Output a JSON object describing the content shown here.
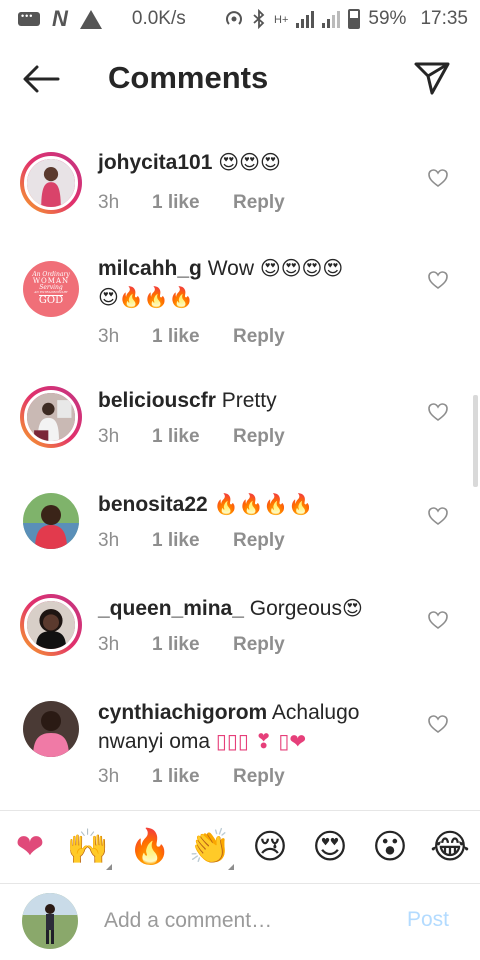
{
  "status_bar": {
    "speed": "0.0K/s",
    "battery": "59%",
    "time": "17:35",
    "signal_label": "H+"
  },
  "header": {
    "title": "Comments",
    "back_icon": "back-arrow-icon",
    "send_icon": "send-icon"
  },
  "comments": [
    {
      "username": "johycita101",
      "text": "",
      "emojis": "😍😍😍",
      "time": "3h",
      "likes": "1 like",
      "reply": "Reply",
      "avatar": "photo-woman-red-dress",
      "ring": true
    },
    {
      "username": "milcahh_g",
      "text": "Wow",
      "emojis": "😍😍😍😍",
      "emojis2": "😍🔥🔥🔥",
      "time": "3h",
      "likes": "1 like",
      "reply": "Reply",
      "avatar": "text-logo",
      "ring": false,
      "avatar_text": [
        "An Ordinary",
        "WOMAN",
        "Serving",
        "AN EXTRAORDINARY",
        "GOD"
      ]
    },
    {
      "username": "beliciouscfr",
      "text": "Pretty",
      "emojis": "",
      "time": "3h",
      "likes": "1 like",
      "reply": "Reply",
      "avatar": "photo-man-indoor",
      "ring": true
    },
    {
      "username": "benosita22",
      "text": "",
      "emojis": "🔥🔥🔥🔥",
      "time": "3h",
      "likes": "1 like",
      "reply": "Reply",
      "avatar": "photo-man-outdoor",
      "ring": false
    },
    {
      "username": "_queen_mina_",
      "text": "Gorgeous",
      "emojis": "😍",
      "time": "3h",
      "likes": "1 like",
      "reply": "Reply",
      "avatar": "photo-woman-smiling",
      "ring": true
    },
    {
      "username": "cynthiachigorom",
      "text": "Achalugo nwanyi oma",
      "emojis": "▯▯▯ ❣ ▯❤",
      "time": "3h",
      "likes": "1 like",
      "reply": "Reply",
      "avatar": "photo-woman-pink",
      "ring": false
    }
  ],
  "quick_emojis": [
    "❤",
    "🙌",
    "🔥",
    "👏",
    "😢",
    "😍",
    "😮",
    "😂"
  ],
  "input": {
    "placeholder": "Add a comment…",
    "post_label": "Post"
  },
  "colors": {
    "text": "#262626",
    "secondary": "#8e8e8e",
    "post_disabled": "#b3dbff",
    "heart": "#ed4956"
  }
}
